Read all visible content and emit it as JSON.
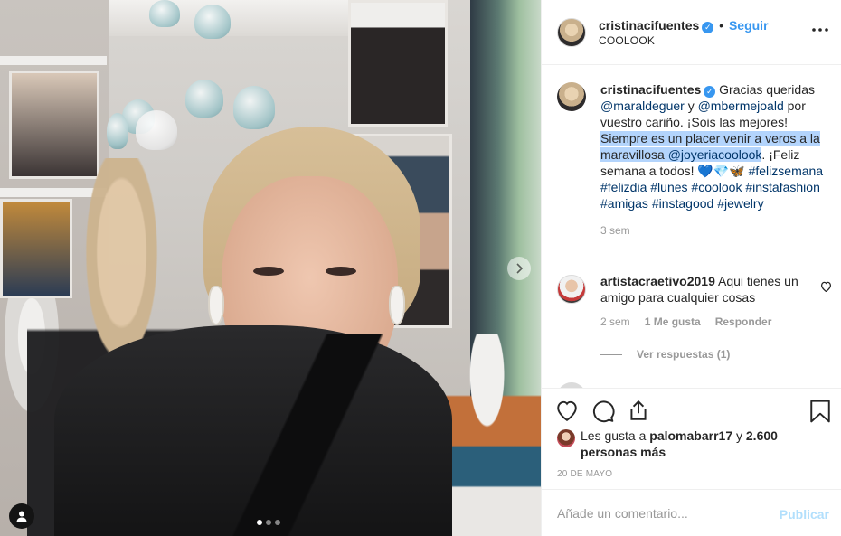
{
  "post": {
    "author": {
      "username": "cristinacifuentes",
      "verified_icon": "verified-badge-icon",
      "separator": "•",
      "follow_label": "Seguir",
      "location": "COOLOOK"
    },
    "more_icon": "more-options-icon",
    "photo": {
      "carousel_count": 3,
      "carousel_active": 1,
      "next_icon": "chevron-right-icon",
      "user_tag_icon": "user-tag-icon"
    },
    "caption": {
      "username": "cristinacifuentes",
      "text_1": "Gracias queridas",
      "mention_1": "@maraldeguer",
      "text_2": " y ",
      "mention_2": "@mbermejoald",
      "text_3": " por vuestro cariño. ¡Sois las mejores! ",
      "text_highlighted": "Siempre es un placer venir a veros a la maravillosa ",
      "mention_3": "@joyeriacoolook",
      "text_4": ". ¡Feliz semana a todos! 💙💎🦋",
      "hashtags": [
        "#felizsemana",
        "#felizdia",
        "#lunes",
        "#coolook",
        "#instafashion",
        "#amigas",
        "#instagood",
        "#jewelry"
      ],
      "time": "3 sem"
    },
    "comments": [
      {
        "username": "artistacraetivo2019",
        "text": "Aqui tienes un amigo para cualquier cosas",
        "time": "2 sem",
        "likes": "1 Me gusta",
        "reply_label": "Responder",
        "view_replies": "Ver respuestas (1)"
      }
    ],
    "actions": {
      "like_icon": "heart-icon",
      "comment_icon": "comment-icon",
      "share_icon": "share-icon",
      "save_icon": "bookmark-icon"
    },
    "likes": {
      "prefix": "Les gusta a ",
      "user": "palomabarr17",
      "middle": " y ",
      "count": "2.600 personas más"
    },
    "date": "20 DE MAYO",
    "add_comment": {
      "placeholder": "Añade un comentario...",
      "publish_label": "Publicar"
    },
    "colors": {
      "link": "#3897f0",
      "mention": "#003569",
      "highlight": "#b3d4fc",
      "publish_disabled": "#b2dffc"
    }
  }
}
